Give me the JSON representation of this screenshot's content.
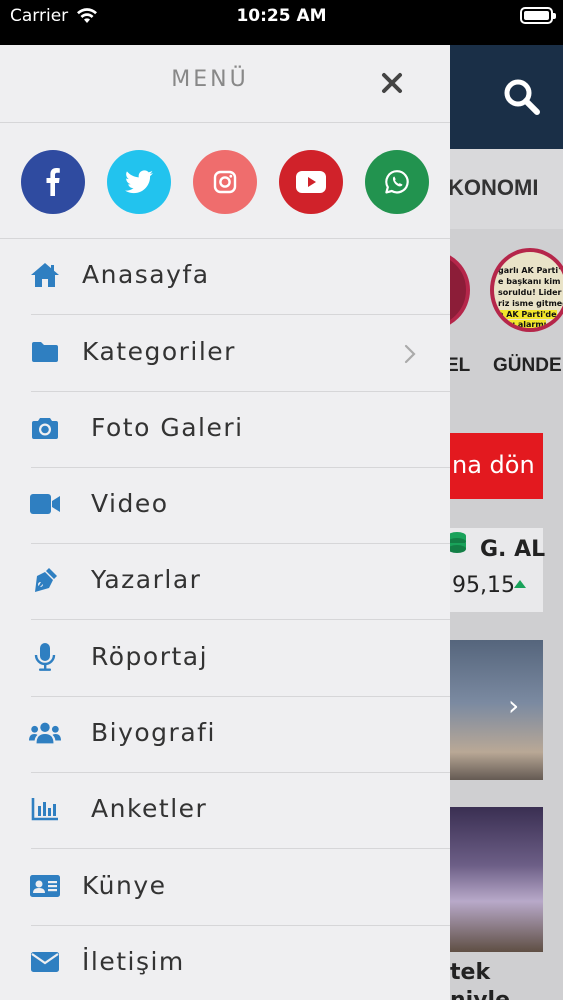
{
  "status_bar": {
    "carrier": "Carrier",
    "time": "10:25 AM"
  },
  "background": {
    "category_label": "KONOMI",
    "story_label_1": "EL",
    "story_label_2": "GÜNDE",
    "story_lines": [
      "garlı AK Parti'",
      "e başkanı kim",
      "soruldu! Lider",
      "riz isme gitmed",
      "e AK Parti'de",
      "rayı alarmı"
    ],
    "banner_text": "na dön",
    "market_name": "G. AL",
    "market_value": "95,15",
    "caption_line1": "tek",
    "caption_line2": "niyle"
  },
  "drawer": {
    "title": "MENÜ",
    "social": [
      {
        "name": "facebook-icon",
        "color": "#2f4ba0"
      },
      {
        "name": "twitter-icon",
        "color": "#22c3ee"
      },
      {
        "name": "instagram-icon",
        "color": "#ef6d6d"
      },
      {
        "name": "youtube-icon",
        "color": "#d0222a"
      },
      {
        "name": "whatsapp-icon",
        "color": "#22934f"
      }
    ],
    "items": [
      {
        "label": "Anasayfa",
        "icon": "home-icon"
      },
      {
        "label": "Kategoriler",
        "icon": "folder-icon",
        "has_submenu": true
      },
      {
        "label": "Foto Galeri",
        "icon": "camera-icon"
      },
      {
        "label": "Video",
        "icon": "video-camera-icon"
      },
      {
        "label": "Yazarlar",
        "icon": "pen-nib-icon"
      },
      {
        "label": "Röportaj",
        "icon": "microphone-icon"
      },
      {
        "label": "Biyografi",
        "icon": "users-icon"
      },
      {
        "label": "Anketler",
        "icon": "poll-chart-icon"
      },
      {
        "label": "Künye",
        "icon": "id-card-icon"
      },
      {
        "label": "İletişim",
        "icon": "envelope-icon"
      }
    ],
    "icon_color": "#2f7fc1"
  }
}
